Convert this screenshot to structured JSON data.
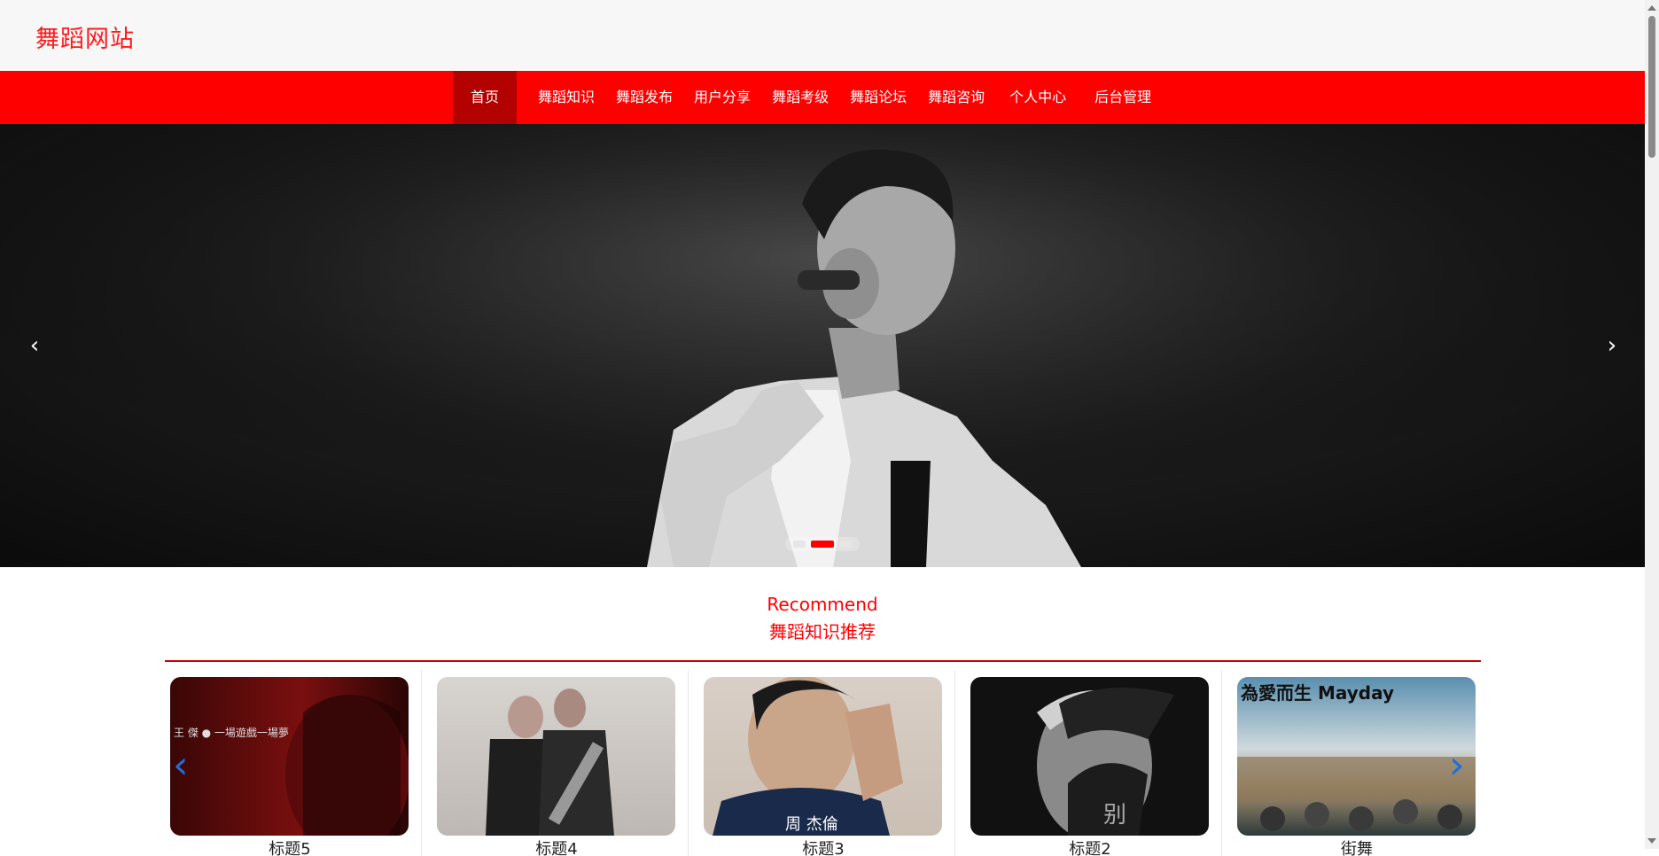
{
  "site": {
    "title": "舞蹈网站",
    "brand_color": "#ff1a1a"
  },
  "nav": {
    "background": "#ff0000",
    "active_background": "#b30000",
    "items": [
      {
        "label": "首页",
        "active": true
      },
      {
        "label": "舞蹈知识"
      },
      {
        "label": "舞蹈发布"
      },
      {
        "label": "用户分享"
      },
      {
        "label": "舞蹈考级"
      },
      {
        "label": "舞蹈论坛"
      },
      {
        "label": "舞蹈咨询"
      },
      {
        "label": "个人中心"
      },
      {
        "label": "后台管理"
      }
    ]
  },
  "carousel": {
    "prev_icon": "chevron-left-icon",
    "next_icon": "chevron-right-icon",
    "slide_count": 3,
    "active_slide": 2,
    "slide_description_visible": false
  },
  "recommend": {
    "title_en": "Recommend",
    "title_zh": "舞蹈知识推荐",
    "prev_icon": "chevron-left-icon",
    "next_icon": "chevron-right-icon",
    "cards": [
      {
        "caption": "标题5",
        "overlay_text": "王 傑 ● 一場遊戲一場夢"
      },
      {
        "caption": "标题4",
        "overlay_text": ""
      },
      {
        "caption": "标题3",
        "overlay_text": "周 杰倫"
      },
      {
        "caption": "标题2",
        "overlay_text": "别"
      },
      {
        "caption": "街舞",
        "overlay_text": "為愛而生 Mayday"
      }
    ]
  }
}
